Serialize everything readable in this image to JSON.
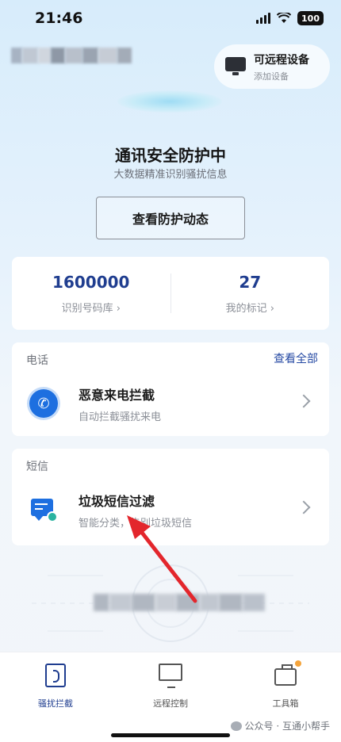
{
  "status_bar": {
    "time": "21:46",
    "battery": "100"
  },
  "header": {
    "remote_device": {
      "title": "可远程设备",
      "subtitle": "添加设备"
    }
  },
  "protection": {
    "title": "通讯安全防护中",
    "subtitle": "大数据精准识别骚扰信息",
    "view_button": "查看防护动态"
  },
  "stats": [
    {
      "value": "1600000",
      "label": "识别号码库 ›"
    },
    {
      "value": "27",
      "label": "我的标记 ›"
    }
  ],
  "phone_section": {
    "header": "电话",
    "view_all": "查看全部",
    "item": {
      "title": "恶意来电拦截",
      "subtitle": "自动拦截骚扰来电",
      "icon": "phone-shield-icon"
    }
  },
  "sms_section": {
    "header": "短信",
    "item": {
      "title": "垃圾短信过滤",
      "subtitle": "智能分类，告别垃圾短信",
      "icon": "sms-filter-icon"
    }
  },
  "bottom_nav": [
    {
      "label": "骚扰拦截",
      "icon": "intercept-icon",
      "active": true
    },
    {
      "label": "远程控制",
      "icon": "remote-control-icon",
      "active": false
    },
    {
      "label": "工具箱",
      "icon": "toolbox-icon",
      "active": false
    }
  ],
  "watermark": "公众号 · 互通小帮手",
  "colors": {
    "accent": "#1f3d8f",
    "link": "#2549a3",
    "icon_blue": "#1d6fe0",
    "annotation_arrow": "#e3262c",
    "badge": "#f4a43c"
  }
}
